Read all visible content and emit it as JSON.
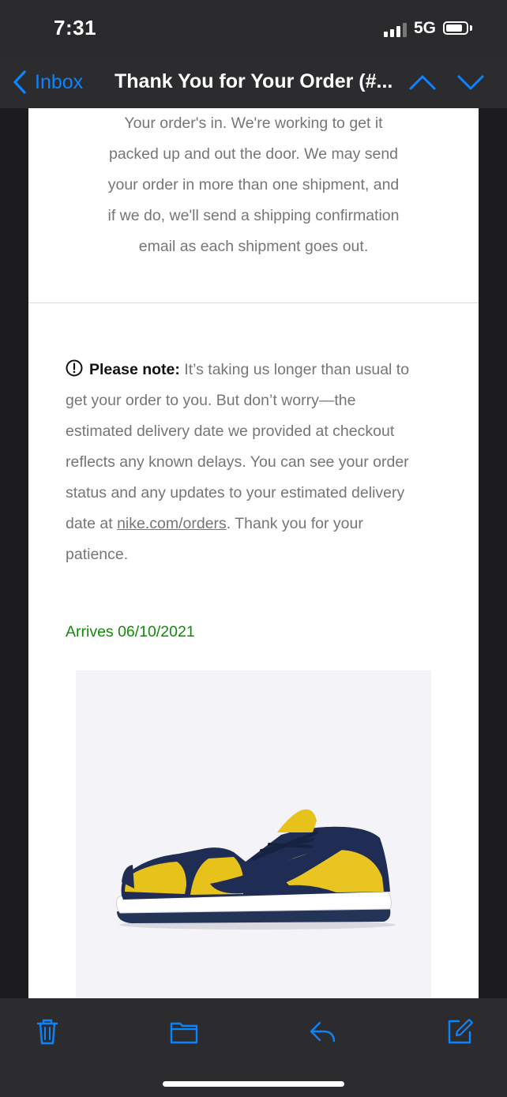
{
  "status_bar": {
    "time": "7:31",
    "network": "5G",
    "battery_level": 0.85,
    "signal_bars": 3,
    "signal_bars_total": 4
  },
  "nav": {
    "back_label": "Inbox",
    "title": "Thank You for Your Order (#...",
    "accent_color": "#0a84ff"
  },
  "email": {
    "intro_lines": [
      "Your order's in. We're working to get it",
      "packed up and out the door. We may send",
      "your order in more than one shipment, and",
      "if we do, we'll send a shipping confirmation",
      "email as each shipment goes out."
    ],
    "note": {
      "label": "Please note:",
      "line1_rest": " It’s taking us longer than usual to",
      "line2": "get your order to you. But don’t worry—the",
      "line3": "estimated delivery date we provided at checkout",
      "line4": "reflects any known delays. You can see your order",
      "line5": "status and any updates to your estimated delivery",
      "line6_before": "date at ",
      "link": "nike.com/orders",
      "line6_after": ". Thank you for your",
      "line7": "patience."
    },
    "arrives": "Arrives 06/10/2021",
    "arrives_color": "#128a09"
  },
  "toolbar": {
    "icons": [
      "trash-icon",
      "folder-icon",
      "reply-icon",
      "compose-icon"
    ]
  }
}
